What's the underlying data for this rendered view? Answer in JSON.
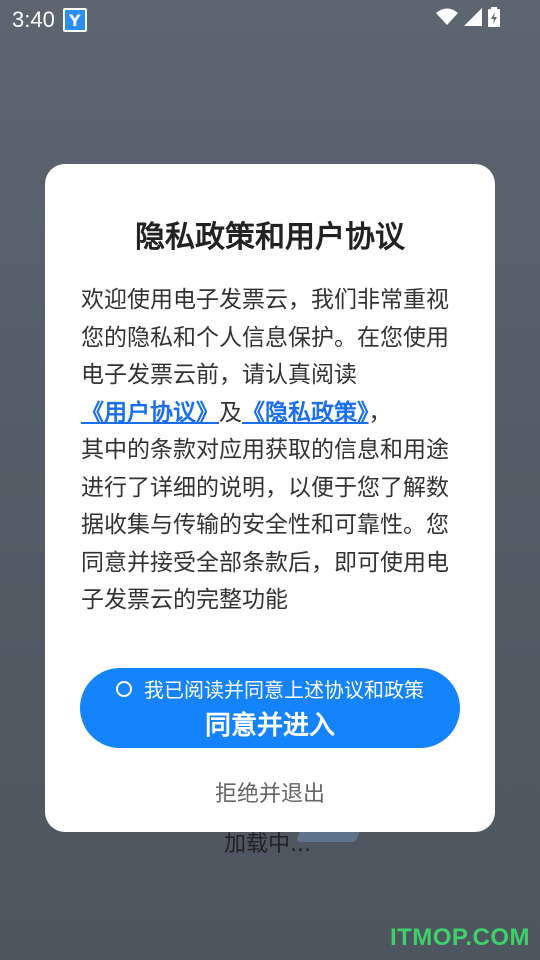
{
  "status_bar": {
    "time": "3:40",
    "app_icon_letter": "Y"
  },
  "background": {
    "loading_text": "加载中...",
    "watermark": "ITMOP.COM"
  },
  "dialog": {
    "title": "隐私政策和用户协议",
    "body_intro": "欢迎使用电子发票云，我们非常重视您的隐私和个人信息保护。在您使用电子发票云前，请认真阅读",
    "link_user_agreement": "《用户协议》",
    "conjunction": "及",
    "link_privacy_policy": "《隐私政策》",
    "body_comma": "，",
    "body_rest": "其中的条款对应用获取的信息和用途进行了详细的说明，以便于您了解数据收集与传输的安全性和可靠性。您同意并接受全部条款后，即可使用电子发票云的完整功能",
    "consent_checkbox_label": "我已阅读并同意上述协议和政策",
    "agree_button_label": "同意并进入",
    "reject_label": "拒绝并退出"
  },
  "colors": {
    "accent": "#1583fb",
    "link": "#1a6ff0",
    "watermark": "#3fd06a"
  }
}
